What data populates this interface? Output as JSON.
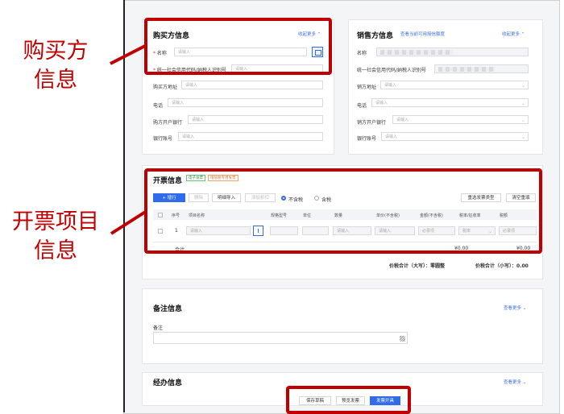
{
  "annotations": {
    "buyer": [
      "购买方",
      "信息"
    ],
    "invoice_items": [
      "开票项目",
      "信息"
    ]
  },
  "buyer": {
    "title": "购买方信息",
    "collapse": "收起更多 ⌃",
    "name_label": "名称",
    "name_placeholder": "请输入",
    "tax_label": "统一社会信用代码/纳税人识别号",
    "tax_placeholder": "请输入",
    "address_label": "购买方地址",
    "address_placeholder": "请输入",
    "phone_label": "电话",
    "phone_placeholder": "请输入",
    "bank_label": "购方开户银行",
    "bank_placeholder": "请输入",
    "account_label": "银行账号",
    "account_placeholder": "请输入"
  },
  "seller": {
    "title": "销售方信息",
    "link": "查看当前可用授信额度",
    "collapse": "收起更多 ⌃",
    "name_label": "名称",
    "tax_label": "统一社会信用代码/纳税人识别号",
    "address_label": "销方地址",
    "address_placeholder": "请输入",
    "phone_label": "电话",
    "phone_placeholder": "请输入",
    "bank_label": "销方开户银行",
    "bank_placeholder": "请输入",
    "account_label": "银行账号",
    "account_placeholder": "请输入"
  },
  "invoice": {
    "title": "开票信息",
    "tag1": "电子发票",
    "tag2": "增值税专用发票",
    "btn_add": "+ 增行",
    "btn_delete": "删除",
    "btn_import": "明细导入",
    "btn_discount": "添加折扣",
    "radio_excl": "不含税",
    "radio_incl": "含税",
    "btn_reselect": "重选发票类型",
    "btn_clear": "清空重填",
    "columns": [
      "序号",
      "项目名称",
      "规格型号",
      "单位",
      "数量",
      "单价(不含税)",
      "金额(不含税)",
      "税率/征收率",
      "税额"
    ],
    "row_index": "1",
    "row_name_placeholder": "请输入",
    "row_qty_placeholder": "请输入",
    "row_price_placeholder": "请输入",
    "row_amount_placeholder": "必录项",
    "row_rate_placeholder": "税率",
    "row_tax_placeholder": "必录项",
    "subtotal_label": "合计",
    "subtotal_amount": "¥0.00",
    "subtotal_tax": "¥0.00",
    "total_upper_label": "价税合计（大写）：",
    "total_upper_value": "零圆整",
    "total_lower_label": "价税合计（小写）：",
    "total_lower_value": "0.00"
  },
  "remarks": {
    "title": "备注信息",
    "more": "查看更多 ⌄",
    "label": "备注"
  },
  "handler": {
    "title": "经办信息",
    "more": "查看更多 ⌄"
  },
  "footer": {
    "save_draft": "保存草稿",
    "preview": "预览发票",
    "issue": "发票开具"
  },
  "colors": {
    "accent": "#2f6bea",
    "annotation": "#c00000"
  }
}
